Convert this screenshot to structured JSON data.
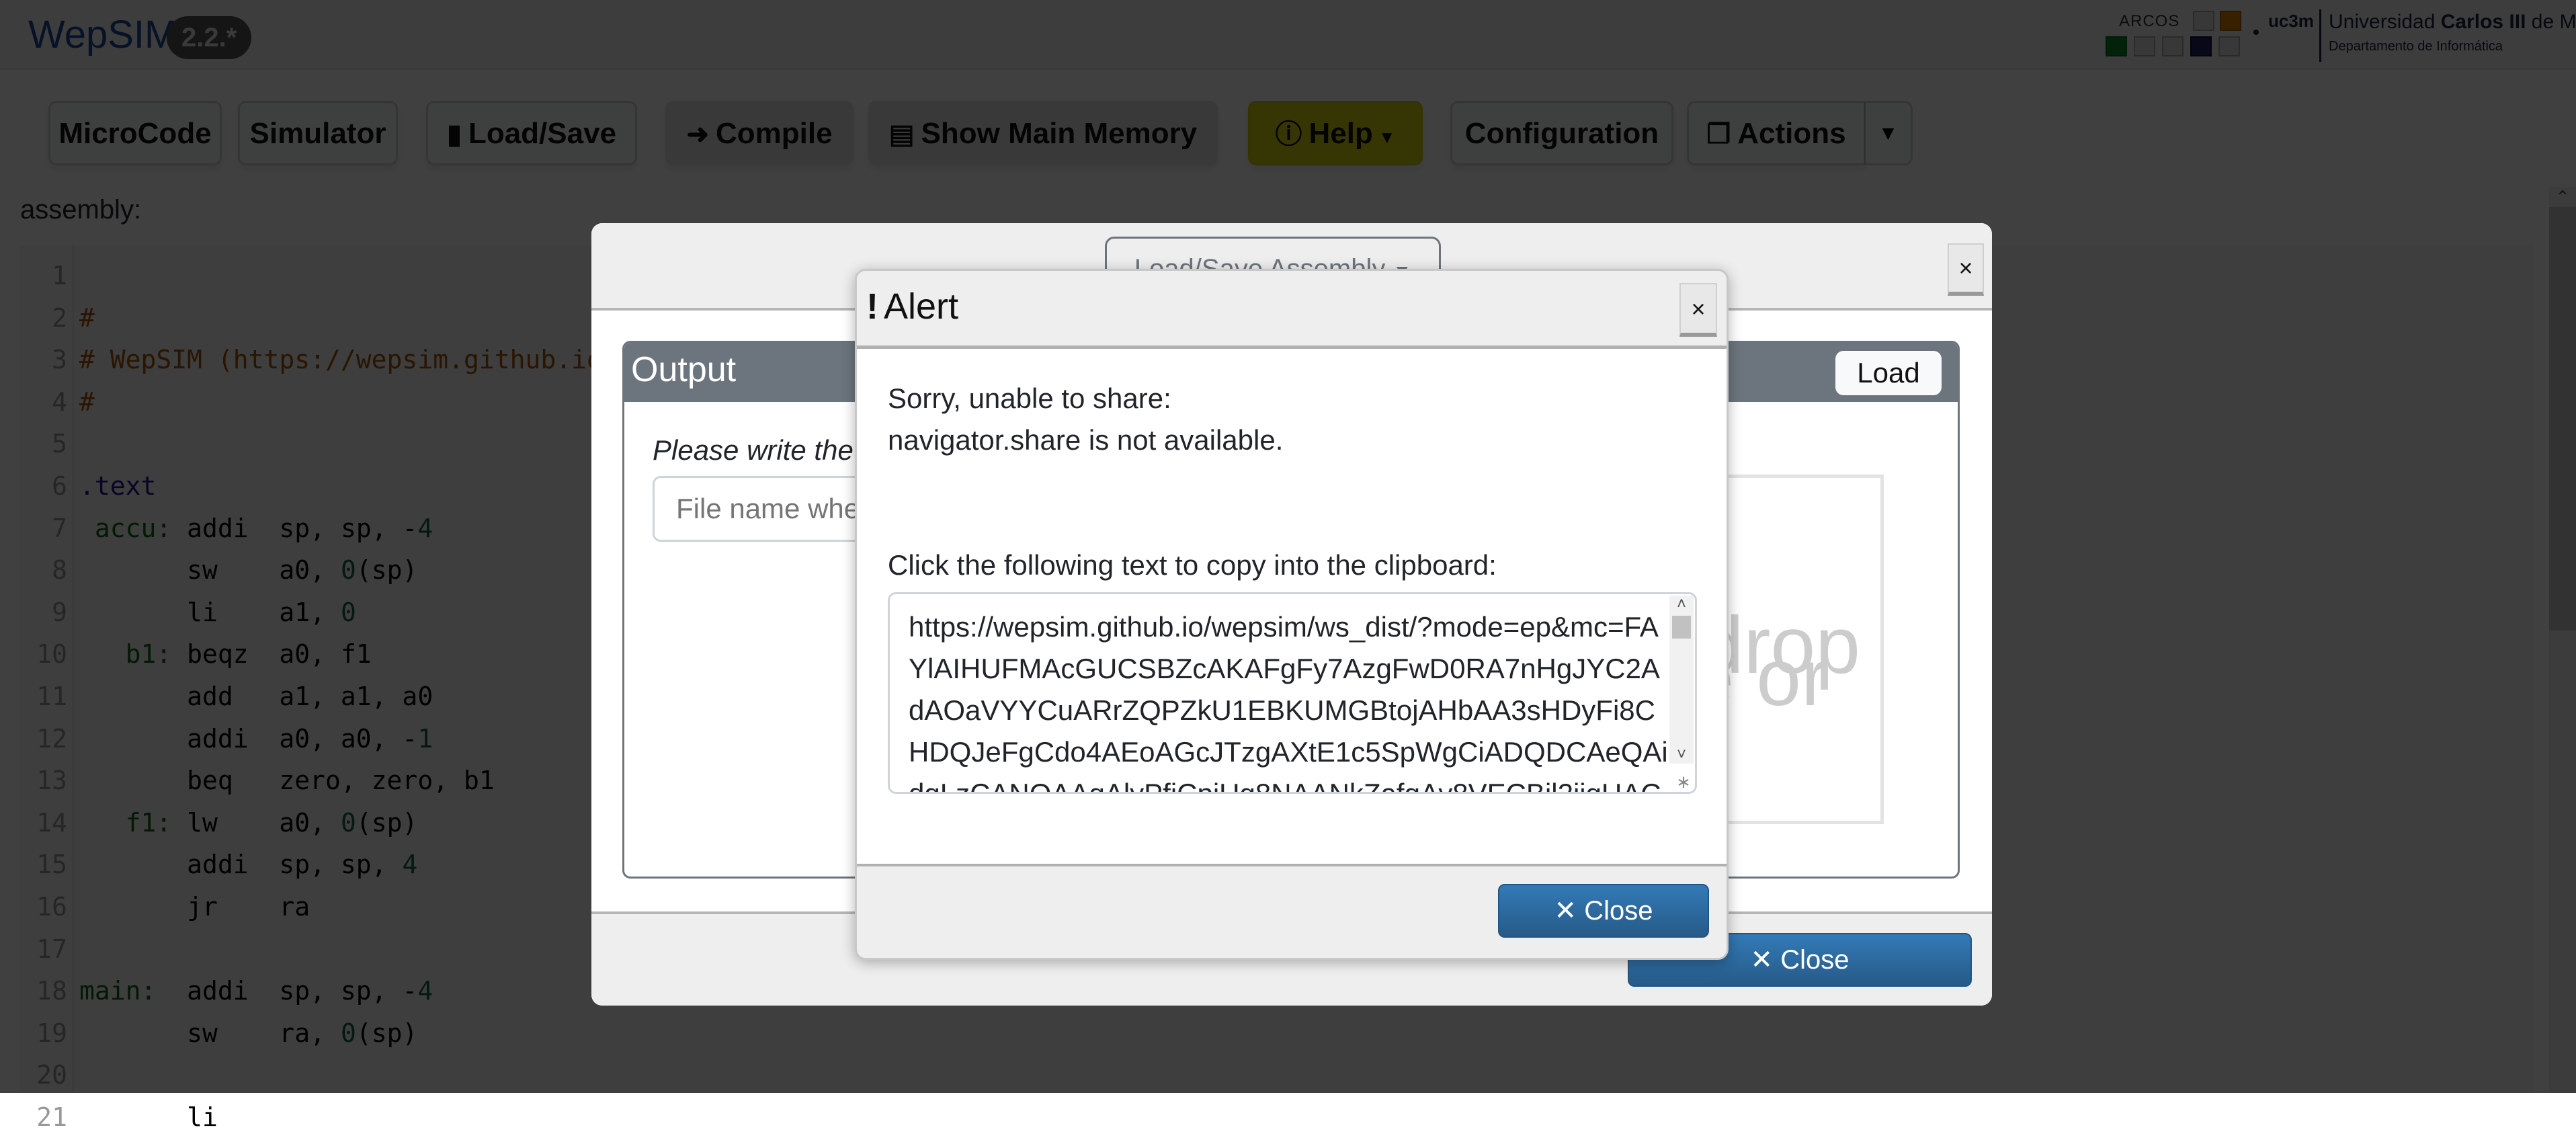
{
  "header": {
    "app_name": "WepSIM",
    "version": "2.2.*",
    "logos": {
      "arcos": "ARCOS",
      "uc3m": "uc3m",
      "university_pre": "Universidad ",
      "university_bold": "Carlos III",
      "university_post": " de Madrid",
      "department": "Departamento de Informática"
    }
  },
  "toolbar": {
    "microcode": "MicroCode",
    "simulator": "Simulator",
    "loadsave": "Load/Save",
    "compile": "Compile",
    "show_memory": "Show Main Memory",
    "help": "Help",
    "configuration": "Configuration",
    "actions": "Actions",
    "icons": {
      "loadsave": "file-icon",
      "compile": "sign-in-icon",
      "show_memory": "memory-icon",
      "help": "info-circle-icon",
      "actions": "clone-icon"
    },
    "colors": {
      "help_bg": "#d6d610"
    }
  },
  "editor": {
    "label": "assembly:",
    "lines": [
      {
        "n": "1",
        "parts": []
      },
      {
        "n": "2",
        "parts": [
          {
            "t": "#",
            "c": "comment"
          }
        ]
      },
      {
        "n": "3",
        "parts": [
          {
            "t": "# WepSIM (https://wepsim.github.io/wepsim)",
            "c": "comment"
          }
        ]
      },
      {
        "n": "4",
        "parts": [
          {
            "t": "#",
            "c": "comment"
          }
        ]
      },
      {
        "n": "5",
        "parts": []
      },
      {
        "n": "6",
        "parts": [
          {
            "t": ".text",
            "c": "dir"
          }
        ]
      },
      {
        "n": "7",
        "parts": [
          {
            "t": " accu:",
            "c": "label"
          },
          {
            "t": " addi  sp, sp, -",
            "c": ""
          },
          {
            "t": "4",
            "c": "num"
          }
        ]
      },
      {
        "n": "8",
        "parts": [
          {
            "t": "       sw    a0, ",
            "c": ""
          },
          {
            "t": "0",
            "c": "num"
          },
          {
            "t": "(sp)",
            "c": ""
          }
        ]
      },
      {
        "n": "9",
        "parts": [
          {
            "t": "       li    a1, ",
            "c": ""
          },
          {
            "t": "0",
            "c": "num"
          }
        ]
      },
      {
        "n": "10",
        "parts": [
          {
            "t": "   b1:",
            "c": "label"
          },
          {
            "t": " beqz  a0, f1",
            "c": ""
          }
        ]
      },
      {
        "n": "11",
        "parts": [
          {
            "t": "       add   a1, a1, a0",
            "c": ""
          }
        ]
      },
      {
        "n": "12",
        "parts": [
          {
            "t": "       addi  a0, a0, -",
            "c": ""
          },
          {
            "t": "1",
            "c": "num"
          }
        ]
      },
      {
        "n": "13",
        "parts": [
          {
            "t": "       beq   zero, zero, b1",
            "c": ""
          }
        ]
      },
      {
        "n": "14",
        "parts": [
          {
            "t": "   f1:",
            "c": "label"
          },
          {
            "t": " lw    a0, ",
            "c": ""
          },
          {
            "t": "0",
            "c": "num"
          },
          {
            "t": "(sp)",
            "c": ""
          }
        ]
      },
      {
        "n": "15",
        "parts": [
          {
            "t": "       addi  sp, sp, ",
            "c": ""
          },
          {
            "t": "4",
            "c": "num"
          }
        ]
      },
      {
        "n": "16",
        "parts": [
          {
            "t": "       jr    ra",
            "c": ""
          }
        ]
      },
      {
        "n": "17",
        "parts": []
      },
      {
        "n": "18",
        "parts": [
          {
            "t": "main:",
            "c": "label"
          },
          {
            "t": "  addi  sp, sp, -",
            "c": ""
          },
          {
            "t": "4",
            "c": "num"
          }
        ]
      },
      {
        "n": "19",
        "parts": [
          {
            "t": "       sw    ra, ",
            "c": ""
          },
          {
            "t": "0",
            "c": "num"
          },
          {
            "t": "(sp)",
            "c": ""
          }
        ]
      },
      {
        "n": "20",
        "parts": []
      },
      {
        "n": "21",
        "parts": [
          {
            "t": "       li",
            "c": ""
          }
        ]
      }
    ]
  },
  "loadsave_modal": {
    "dropdown_label": "Load/Save Assembly",
    "close_x": "×",
    "card_title": "Output",
    "load_button": "Load",
    "hint": "Please write the file name",
    "filename_placeholder": "File name where assembly will be saved",
    "dropzone_line1": "drop",
    "dropzone_line2": "e or",
    "close_button": "Close"
  },
  "alert_modal": {
    "title_icon": "!",
    "title": "Alert",
    "close_x": "×",
    "message_line1": "Sorry, unable to share:",
    "message_line2": "navigator.share is not available.",
    "copy_label": "Click the following text to copy into the clipboard:",
    "share_url": "https://wepsim.github.io/wepsim/ws_dist/?mode=ep&mc=FAYlAIHUFMAcGUCSBZcAKAFgFy7AzgFwD0RA7nHgJYC2AdAOaVYYCuARrZQPZkU1EBKUMGBtojAHbAA3sHDyFi8CHDQJeFgCdo4AEoAGcJTzgAXtE1c5SpWgCiADQDCAeQAidgLzCANQAAgAlyPfjCpiUg8NAANkZafgAy8VECBjl2jjgUACbei",
    "close_button": "Close"
  },
  "icons": {
    "close": "times-icon",
    "dropdown": "caret-down-icon",
    "scroll_up": "chevron-up-icon"
  }
}
